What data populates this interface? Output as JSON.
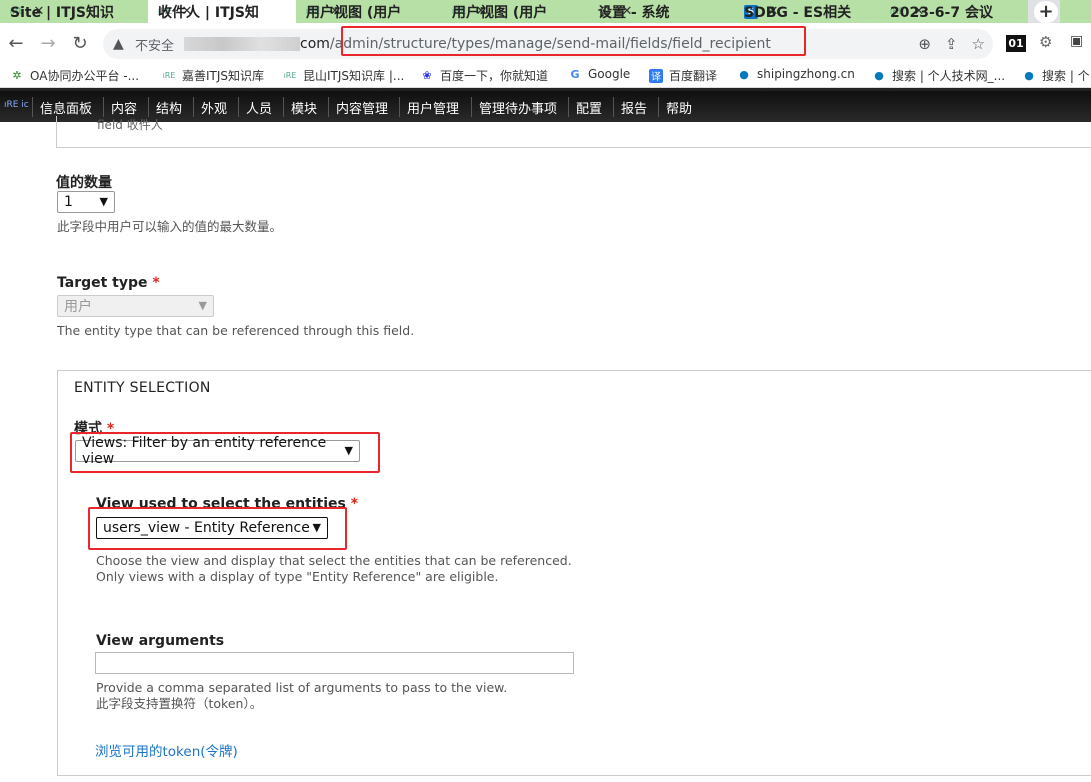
{
  "tabs": [
    {
      "label": "Site | ITJS知识"
    },
    {
      "label": "收件人 | ITJS知"
    },
    {
      "label": "用户视图 (用户"
    },
    {
      "label": "用户视图 (用户"
    },
    {
      "label": "设置 - 系统"
    },
    {
      "label": "SDBG - ES相关"
    },
    {
      "label": "2023-6-7 会议"
    }
  ],
  "address": {
    "security_label": "不安全",
    "domain": "com",
    "path": "/admin/structure/types/manage/send-mail/fields/field_recipient"
  },
  "extensions": {
    "ext_01": "01"
  },
  "bookmarks": [
    {
      "label": "OA协同办公平台 -..."
    },
    {
      "label": "嘉善ITJS知识库"
    },
    {
      "label": "昆山ITJS知识库 |..."
    },
    {
      "label": "百度一下，你就知道"
    },
    {
      "label": "Google"
    },
    {
      "label": "百度翻译"
    },
    {
      "label": "shipingzhong.cn"
    },
    {
      "label": "搜索 | 个人技术网_..."
    },
    {
      "label": "搜索 | 个"
    }
  ],
  "admin_menu": [
    {
      "label": "信息面板"
    },
    {
      "label": "内容"
    },
    {
      "label": "结构"
    },
    {
      "label": "外观"
    },
    {
      "label": "人员"
    },
    {
      "label": "模块"
    },
    {
      "label": "内容管理"
    },
    {
      "label": "用户管理"
    },
    {
      "label": "管理待办事项"
    },
    {
      "label": "配置"
    },
    {
      "label": "报告"
    },
    {
      "label": "帮助"
    }
  ],
  "form": {
    "prev_field_text": "field 收件人",
    "cardinality": {
      "label": "值的数量",
      "value": "1",
      "description": "此字段中用户可以输入的值的最大数量。"
    },
    "target_type": {
      "label": "Target type",
      "required_mark": "*",
      "value": "用户",
      "description": "The entity type that can be referenced through this field."
    },
    "entity_selection": {
      "legend": "ENTITY SELECTION",
      "mode": {
        "label": "模式",
        "required_mark": "*",
        "value": "Views: Filter by an entity reference view"
      },
      "view": {
        "label": "View used to select the entities",
        "required_mark": "*",
        "value": "users_view - Entity Reference",
        "description_line1": "Choose the view and display that select the entities that can be referenced.",
        "description_line2": "Only views with a display of type \"Entity Reference\" are eligible."
      },
      "view_arguments": {
        "label": "View arguments",
        "value": "",
        "description_line1": "Provide a comma separated list of arguments to pass to the view.",
        "description_line2": "此字段支持置换符（token）。"
      },
      "token_link": "浏览可用的token(令牌)"
    }
  },
  "colors": {
    "highlight": "#e8262b",
    "link": "#1a73c7",
    "required": "#e3261b"
  }
}
